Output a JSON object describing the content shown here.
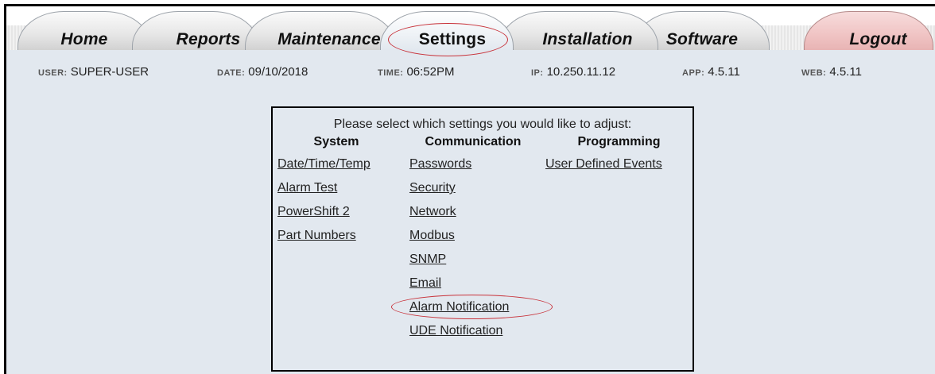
{
  "nav": {
    "tabs": [
      "Home",
      "Reports",
      "Maintenance",
      "Settings",
      "Installation",
      "Software"
    ],
    "logout": "Logout",
    "active": "Settings"
  },
  "info": {
    "user_key": "USER:",
    "user_val": "SUPER-USER",
    "date_key": "DATE:",
    "date_val": "09/10/2018",
    "time_key": "TIME:",
    "time_val": "06:52PM",
    "ip_key": "IP:",
    "ip_val": "10.250.11.12",
    "app_key": "APP:",
    "app_val": "4.5.11",
    "web_key": "WEB:",
    "web_val": "4.5.11"
  },
  "panel": {
    "prompt": "Please select which settings you would like to adjust:",
    "system": {
      "header": "System",
      "links": [
        "Date/Time/Temp",
        "Alarm Test",
        "PowerShift 2",
        "Part Numbers"
      ]
    },
    "communication": {
      "header": "Communication",
      "links": [
        "Passwords",
        "Security",
        "Network",
        "Modbus",
        "SNMP",
        "Email",
        "Alarm Notification",
        "UDE Notification"
      ]
    },
    "programming": {
      "header": "Programming",
      "links": [
        "User Defined Events"
      ]
    }
  },
  "colors": {
    "background": "#e2e8ef",
    "highlight_circle": "#c8323a",
    "logout_tab": "#f0c4c4"
  }
}
